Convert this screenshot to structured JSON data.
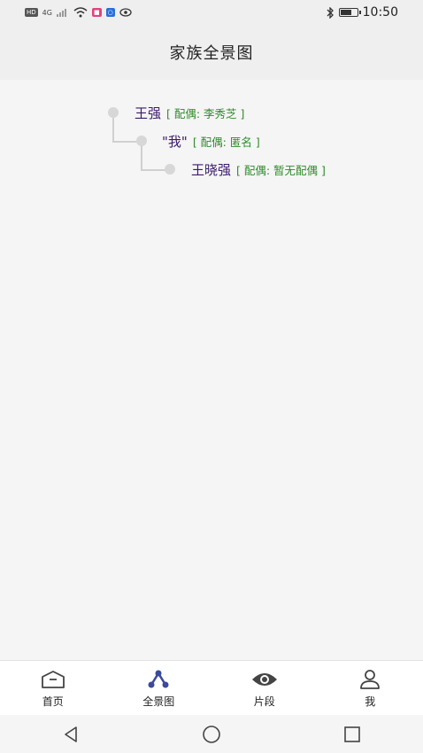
{
  "status_bar": {
    "left_chips": [
      "HD",
      "4G"
    ],
    "time": "10:50"
  },
  "header": {
    "title": "家族全景图"
  },
  "tree": {
    "nodes": [
      {
        "name": "王强",
        "spouse": "[ 配偶: 李秀芝 ]"
      },
      {
        "name": "\"我\"",
        "spouse": "[ 配偶: 匿名 ]"
      },
      {
        "name": "王晓强",
        "spouse": "[ 配偶: 暂无配偶 ]"
      }
    ]
  },
  "bottom_nav": {
    "items": [
      {
        "label": "首页",
        "icon": "home-icon"
      },
      {
        "label": "全景图",
        "icon": "tree-icon"
      },
      {
        "label": "片段",
        "icon": "eye-icon"
      },
      {
        "label": "我",
        "icon": "person-icon"
      }
    ],
    "active_color": "#3b4a9a"
  },
  "system_nav": [
    "back-icon",
    "home-circle-icon",
    "recents-icon"
  ]
}
